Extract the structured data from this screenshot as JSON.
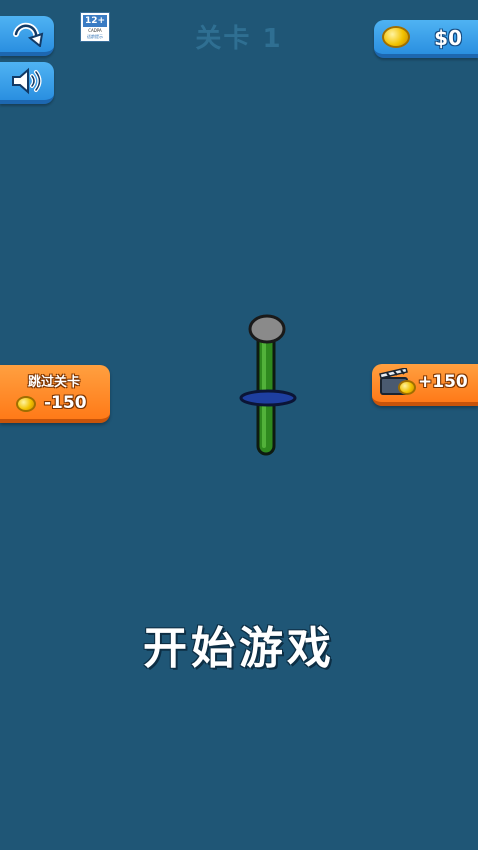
{
  "header": {
    "level_title": "关卡 1",
    "coins": "$0",
    "age_rating": {
      "number": "12+",
      "line1": "CADPA",
      "line2": "适龄提示"
    }
  },
  "icons": {
    "restart": "restart-icon",
    "sound": "speaker-icon",
    "coin": "coin-icon",
    "video": "video-clapper-icon"
  },
  "side_buttons": {
    "skip_label": "跳过关卡",
    "skip_cost": "-150",
    "reward_value": "+150"
  },
  "main": {
    "start_text": "开始游戏"
  },
  "colors": {
    "background": "#1f5676",
    "blue_button": "#2a8fe0",
    "orange_button": "#ff7a18",
    "stick": "#2f8a1e",
    "ring": "#1e3fa0",
    "knob": "#8a8a8a"
  }
}
